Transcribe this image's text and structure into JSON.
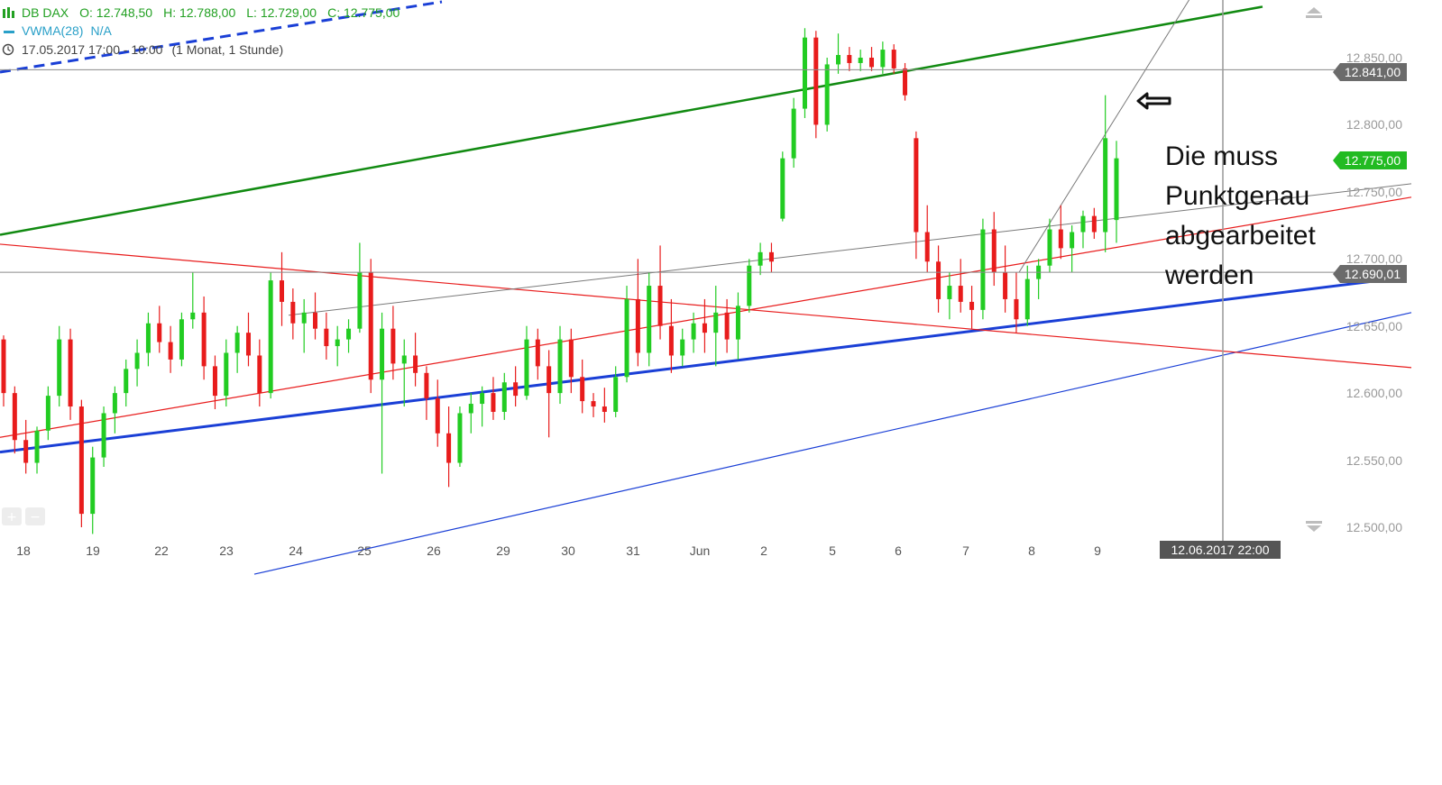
{
  "legend": {
    "instrument": "DB DAX",
    "open": "O: 12.748,50",
    "high": "H: 12.788,00",
    "low": "L: 12.729,00",
    "close": "C: 12.775,00",
    "indicator": "VWMA(28)",
    "indicator_value": "N/A",
    "period": "17.05.2017 17:00 - 10:00",
    "interval": "(1 Monat, 1 Stunde)"
  },
  "annotation": {
    "line1": "Die muss",
    "line2": "Punktgenau",
    "line3": "abgearbeitet",
    "line4": "werden"
  },
  "colors": {
    "up": "#22cc22",
    "down": "#e81c1c",
    "green_line": "#118a11",
    "blue_line": "#1a3fd6",
    "red_line": "#e81c1c",
    "gray_line": "#7a7a7a",
    "tag_gray": "#6b6b6b",
    "tag_green": "#22bb22",
    "crosshair_tag": "#555555"
  },
  "icons": {
    "scroll_up": "triangle-up-icon",
    "scroll_down": "triangle-down-icon",
    "arrow_annotation": "arrow-left-icon",
    "zoom_buttons": "plus-minus-icon"
  },
  "chart_data": {
    "type": "candlestick",
    "y_range": [
      12490,
      12880
    ],
    "yticks": [
      12500,
      12550,
      12600,
      12650,
      12700,
      12750,
      12800,
      12850
    ],
    "ytick_labels": [
      "12.500,00",
      "12.550,00",
      "12.600,00",
      "12.650,00",
      "12.700,00",
      "12.750,00",
      "12.800,00",
      "12.850,00"
    ],
    "x_labels": [
      "18",
      "19",
      "22",
      "23",
      "24",
      "25",
      "26",
      "29",
      "30",
      "31",
      "Jun",
      "2",
      "5",
      "6",
      "7",
      "8",
      "9"
    ],
    "price_tags": [
      {
        "label": "12.841,00",
        "value": 12841,
        "color": "#6b6b6b"
      },
      {
        "label": "12.775,00",
        "value": 12775,
        "color": "#22bb22"
      },
      {
        "label": "12.690,01",
        "value": 12690.01,
        "color": "#6b6b6b"
      }
    ],
    "horizontal_lines": [
      12841,
      12690.01
    ],
    "crosshair": {
      "label": "12.06.2017 22:00"
    },
    "trendlines": [
      {
        "name": "green",
        "color": "#118a11",
        "width": 2.5,
        "p1": [
          0,
          12718
        ],
        "p2": [
          1400,
          12888
        ]
      },
      {
        "name": "blue-thick",
        "color": "#1a3fd6",
        "width": 3,
        "p1": [
          0,
          12556
        ],
        "p2": [
          1530,
          12684
        ]
      },
      {
        "name": "blue-thin",
        "color": "#1a3fd6",
        "width": 1.2,
        "p1": [
          282,
          12465
        ],
        "p2": [
          1565,
          12660
        ]
      },
      {
        "name": "red-desc",
        "color": "#e81c1c",
        "width": 1.2,
        "p1": [
          0,
          12711
        ],
        "p2": [
          1565,
          12619
        ]
      },
      {
        "name": "red-asc",
        "color": "#e81c1c",
        "width": 1.2,
        "p1": [
          0,
          12567
        ],
        "p2": [
          1565,
          12746
        ]
      },
      {
        "name": "gray-asc",
        "color": "#7a7a7a",
        "width": 1,
        "p1": [
          320,
          12658
        ],
        "p2": [
          1565,
          12756
        ]
      },
      {
        "name": "gray-steep",
        "color": "#7a7a7a",
        "width": 1,
        "p1": [
          1130,
          12690
        ],
        "p2": [
          1325,
          12900
        ]
      }
    ],
    "candles": [
      [
        12640,
        12643,
        12590,
        12600
      ],
      [
        12600,
        12605,
        12555,
        12565
      ],
      [
        12565,
        12580,
        12540,
        12548
      ],
      [
        12548,
        12575,
        12540,
        12572
      ],
      [
        12572,
        12605,
        12565,
        12598
      ],
      [
        12598,
        12650,
        12590,
        12640
      ],
      [
        12640,
        12648,
        12580,
        12590
      ],
      [
        12590,
        12595,
        12500,
        12510
      ],
      [
        12510,
        12560,
        12495,
        12552
      ],
      [
        12552,
        12590,
        12545,
        12585
      ],
      [
        12585,
        12605,
        12570,
        12600
      ],
      [
        12600,
        12625,
        12590,
        12618
      ],
      [
        12618,
        12640,
        12605,
        12630
      ],
      [
        12630,
        12660,
        12620,
        12652
      ],
      [
        12652,
        12665,
        12630,
        12638
      ],
      [
        12638,
        12650,
        12615,
        12625
      ],
      [
        12625,
        12660,
        12620,
        12655
      ],
      [
        12655,
        12690,
        12648,
        12660
      ],
      [
        12660,
        12672,
        12610,
        12620
      ],
      [
        12620,
        12628,
        12588,
        12598
      ],
      [
        12598,
        12640,
        12590,
        12630
      ],
      [
        12630,
        12650,
        12615,
        12645
      ],
      [
        12645,
        12660,
        12620,
        12628
      ],
      [
        12628,
        12640,
        12590,
        12600
      ],
      [
        12600,
        12690,
        12596,
        12684
      ],
      [
        12684,
        12705,
        12650,
        12668
      ],
      [
        12668,
        12678,
        12640,
        12652
      ],
      [
        12652,
        12670,
        12630,
        12660
      ],
      [
        12660,
        12675,
        12640,
        12648
      ],
      [
        12648,
        12660,
        12625,
        12635
      ],
      [
        12635,
        12650,
        12620,
        12640
      ],
      [
        12640,
        12655,
        12630,
        12648
      ],
      [
        12648,
        12712,
        12645,
        12690
      ],
      [
        12690,
        12700,
        12600,
        12610
      ],
      [
        12610,
        12660,
        12540,
        12648
      ],
      [
        12648,
        12665,
        12610,
        12622
      ],
      [
        12622,
        12640,
        12590,
        12628
      ],
      [
        12628,
        12645,
        12605,
        12615
      ],
      [
        12615,
        12620,
        12580,
        12596
      ],
      [
        12596,
        12610,
        12560,
        12570
      ],
      [
        12570,
        12590,
        12530,
        12548
      ],
      [
        12548,
        12590,
        12545,
        12585
      ],
      [
        12585,
        12600,
        12570,
        12592
      ],
      [
        12592,
        12605,
        12575,
        12600
      ],
      [
        12600,
        12612,
        12580,
        12586
      ],
      [
        12586,
        12615,
        12580,
        12608
      ],
      [
        12608,
        12620,
        12590,
        12598
      ],
      [
        12598,
        12650,
        12595,
        12640
      ],
      [
        12640,
        12648,
        12610,
        12620
      ],
      [
        12620,
        12632,
        12567,
        12600
      ],
      [
        12600,
        12650,
        12592,
        12640
      ],
      [
        12640,
        12648,
        12600,
        12612
      ],
      [
        12612,
        12625,
        12585,
        12594
      ],
      [
        12594,
        12600,
        12582,
        12590
      ],
      [
        12590,
        12604,
        12578,
        12586
      ],
      [
        12586,
        12620,
        12582,
        12612
      ],
      [
        12612,
        12680,
        12608,
        12670
      ],
      [
        12670,
        12700,
        12620,
        12630
      ],
      [
        12630,
        12690,
        12620,
        12680
      ],
      [
        12680,
        12710,
        12640,
        12650
      ],
      [
        12650,
        12670,
        12615,
        12628
      ],
      [
        12628,
        12648,
        12620,
        12640
      ],
      [
        12640,
        12660,
        12630,
        12652
      ],
      [
        12652,
        12670,
        12630,
        12645
      ],
      [
        12645,
        12680,
        12620,
        12660
      ],
      [
        12660,
        12670,
        12630,
        12640
      ],
      [
        12640,
        12675,
        12625,
        12665
      ],
      [
        12665,
        12700,
        12660,
        12695
      ],
      [
        12695,
        12712,
        12688,
        12705
      ],
      [
        12705,
        12712,
        12690,
        12698
      ],
      [
        12730,
        12780,
        12728,
        12775
      ],
      [
        12775,
        12820,
        12768,
        12812
      ],
      [
        12812,
        12872,
        12805,
        12865
      ],
      [
        12865,
        12870,
        12790,
        12800
      ],
      [
        12800,
        12850,
        12795,
        12845
      ],
      [
        12845,
        12868,
        12838,
        12852
      ],
      [
        12852,
        12858,
        12840,
        12846
      ],
      [
        12846,
        12856,
        12840,
        12850
      ],
      [
        12850,
        12858,
        12840,
        12843
      ],
      [
        12843,
        12862,
        12838,
        12856
      ],
      [
        12856,
        12860,
        12838,
        12842
      ],
      [
        12842,
        12846,
        12818,
        12822
      ],
      [
        12790,
        12795,
        12700,
        12720
      ],
      [
        12720,
        12740,
        12690,
        12698
      ],
      [
        12698,
        12710,
        12660,
        12670
      ],
      [
        12670,
        12690,
        12655,
        12680
      ],
      [
        12680,
        12700,
        12660,
        12668
      ],
      [
        12668,
        12680,
        12648,
        12662
      ],
      [
        12662,
        12730,
        12655,
        12722
      ],
      [
        12722,
        12735,
        12680,
        12690
      ],
      [
        12690,
        12710,
        12660,
        12670
      ],
      [
        12670,
        12690,
        12645,
        12655
      ],
      [
        12655,
        12695,
        12650,
        12685
      ],
      [
        12685,
        12700,
        12670,
        12695
      ],
      [
        12695,
        12730,
        12690,
        12722
      ],
      [
        12722,
        12740,
        12700,
        12708
      ],
      [
        12708,
        12725,
        12690,
        12720
      ],
      [
        12720,
        12736,
        12708,
        12732
      ],
      [
        12732,
        12738,
        12715,
        12720
      ],
      [
        12720,
        12822,
        12705,
        12790
      ],
      [
        12729,
        12788,
        12712,
        12775
      ]
    ]
  }
}
